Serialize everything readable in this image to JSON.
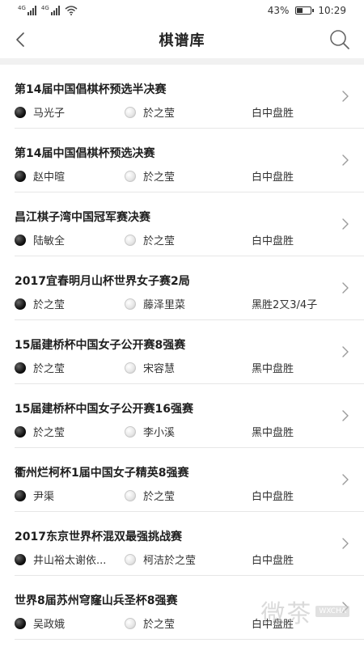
{
  "status_bar": {
    "signal_1_label": "4G",
    "signal_2_label": "4G",
    "battery_percent": "43%",
    "battery_level": 0.43,
    "time": "10:29"
  },
  "header": {
    "title": "棋谱库",
    "back_icon": "chevron-left-icon",
    "search_icon": "search-icon"
  },
  "games": [
    {
      "title": "第14届中国倡棋杯预选半决赛",
      "black": "马光子",
      "white": "於之莹",
      "result": "白中盘胜"
    },
    {
      "title": "第14届中国倡棋杯预选决赛",
      "black": "赵中暄",
      "white": "於之莹",
      "result": "白中盘胜"
    },
    {
      "title": "昌江棋子湾中国冠军赛决赛",
      "black": "陆敏全",
      "white": "於之莹",
      "result": "白中盘胜"
    },
    {
      "title": "2017宜春明月山杯世界女子赛2局",
      "black": "於之莹",
      "white": "藤泽里菜",
      "result": "黑胜2又3/4子"
    },
    {
      "title": "15届建桥杯中国女子公开赛8强赛",
      "black": "於之莹",
      "white": "宋容慧",
      "result": "黑中盘胜"
    },
    {
      "title": "15届建桥杯中国女子公开赛16强赛",
      "black": "於之莹",
      "white": "李小溪",
      "result": "黑中盘胜"
    },
    {
      "title": "衢州烂柯杯1届中国女子精英8强赛",
      "black": "尹渠",
      "white": "於之莹",
      "result": "白中盘胜"
    },
    {
      "title": "2017东京世界杯混双最强挑战赛",
      "black": "井山裕太谢依...",
      "white": "柯洁於之莹",
      "result": "白中盘胜"
    },
    {
      "title": "世界8届苏州穹窿山兵圣杯8强赛",
      "black": "吴政娥",
      "white": "於之莹",
      "result": "白中盘胜"
    }
  ],
  "watermark": {
    "text": "微茶",
    "badge": "WXCHA"
  }
}
